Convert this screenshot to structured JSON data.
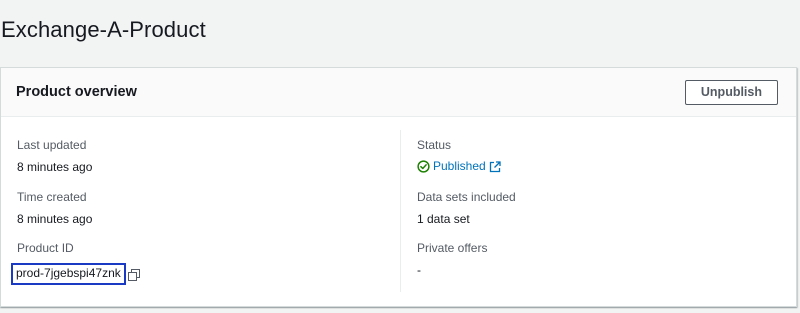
{
  "page": {
    "title": "Exchange-A-Product"
  },
  "overview": {
    "title": "Product overview",
    "unpublish_label": "Unpublish",
    "fields": {
      "last_updated": {
        "label": "Last updated",
        "value": "8 minutes ago"
      },
      "time_created": {
        "label": "Time created",
        "value": "8 minutes ago"
      },
      "product_id": {
        "label": "Product ID",
        "value": "prod-7jgebspi47znk"
      },
      "status": {
        "label": "Status",
        "value": "Published"
      },
      "data_sets": {
        "label": "Data sets included",
        "value": "1 data set"
      },
      "private_offers": {
        "label": "Private offers",
        "value": "-"
      }
    }
  },
  "icons": {
    "copy": "copy-icon",
    "status": "check-circle-icon",
    "external": "external-link-icon"
  },
  "colors": {
    "status_green": "#1d8102",
    "link_blue": "#0073bb",
    "highlight_box": "#1a3ac4"
  }
}
